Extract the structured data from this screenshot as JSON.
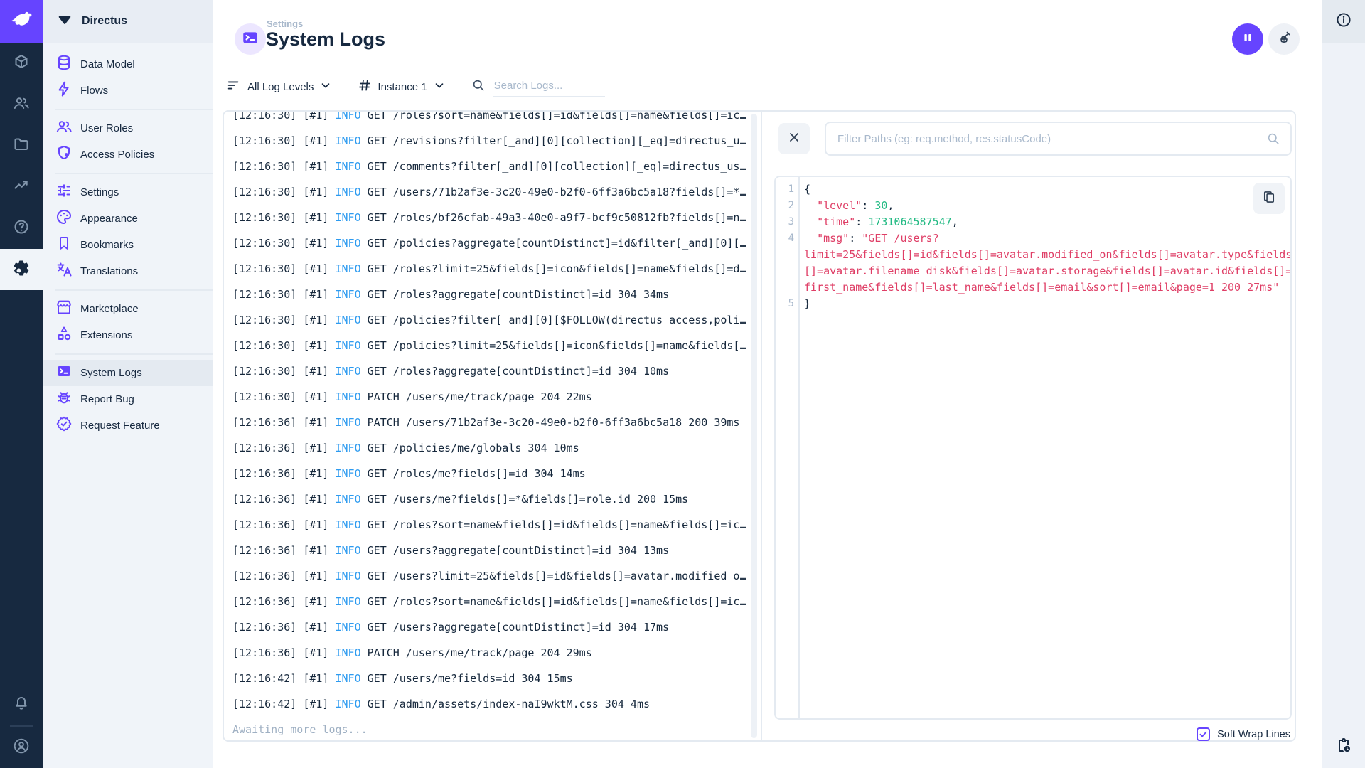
{
  "app": {
    "accent_color": "#6644ff",
    "info_blue": "#2d9bf0",
    "code_red": "#df3e66",
    "code_green": "#22ba83"
  },
  "nav": {
    "header_title": "Directus",
    "sections": [
      [
        {
          "id": "data-model",
          "icon": "database-icon",
          "label": "Data Model",
          "active": false
        },
        {
          "id": "flows",
          "icon": "bolt-icon",
          "label": "Flows",
          "active": false
        }
      ],
      [
        {
          "id": "user-roles",
          "icon": "people-icon",
          "label": "User Roles",
          "active": false
        },
        {
          "id": "access-policies",
          "icon": "shield-icon",
          "label": "Access Policies",
          "active": false
        }
      ],
      [
        {
          "id": "settings",
          "icon": "tune-icon",
          "label": "Settings",
          "active": false
        },
        {
          "id": "appearance",
          "icon": "palette-icon",
          "label": "Appearance",
          "active": false
        },
        {
          "id": "bookmarks",
          "icon": "bookmark-icon",
          "label": "Bookmarks",
          "active": false
        },
        {
          "id": "translations",
          "icon": "translate-icon",
          "label": "Translations",
          "active": false
        }
      ],
      [
        {
          "id": "marketplace",
          "icon": "storefront-icon",
          "label": "Marketplace",
          "active": false
        },
        {
          "id": "extensions",
          "icon": "shapes-icon",
          "label": "Extensions",
          "active": false
        }
      ],
      [
        {
          "id": "system-logs",
          "icon": "terminal-icon",
          "label": "System Logs",
          "active": true
        },
        {
          "id": "report-bug",
          "icon": "bug-icon",
          "label": "Report Bug",
          "active": false
        },
        {
          "id": "request-feature",
          "icon": "verified-icon",
          "label": "Request Feature",
          "active": false
        }
      ]
    ]
  },
  "header": {
    "breadcrumb": "Settings",
    "title": "System Logs"
  },
  "toolbar": {
    "log_level_filter": "All Log Levels",
    "instance_filter": "Instance 1",
    "search_placeholder": "Search Logs..."
  },
  "logs": {
    "awaiting": "Awaiting more logs...",
    "rows": [
      {
        "time": "12:16:30",
        "tag": "#1",
        "level": "INFO",
        "msg": "GET /roles?sort=name&fields[]=id&fields[]=name&fields[]=ic…"
      },
      {
        "time": "12:16:30",
        "tag": "#1",
        "level": "INFO",
        "msg": "GET /revisions?filter[_and][0][collection][_eq]=directus_u…"
      },
      {
        "time": "12:16:30",
        "tag": "#1",
        "level": "INFO",
        "msg": "GET /comments?filter[_and][0][collection][_eq]=directus_us…"
      },
      {
        "time": "12:16:30",
        "tag": "#1",
        "level": "INFO",
        "msg": "GET /users/71b2af3e-3c20-49e0-b2f0-6ff3a6bc5a18?fields[]=*…"
      },
      {
        "time": "12:16:30",
        "tag": "#1",
        "level": "INFO",
        "msg": "GET /roles/bf26cfab-49a3-40e0-a9f7-bcf9c50812fb?fields[]=n…"
      },
      {
        "time": "12:16:30",
        "tag": "#1",
        "level": "INFO",
        "msg": "GET /policies?aggregate[countDistinct]=id&filter[_and][0][…"
      },
      {
        "time": "12:16:30",
        "tag": "#1",
        "level": "INFO",
        "msg": "GET /roles?limit=25&fields[]=icon&fields[]=name&fields[]=d…"
      },
      {
        "time": "12:16:30",
        "tag": "#1",
        "level": "INFO",
        "msg": "GET /roles?aggregate[countDistinct]=id 304 34ms"
      },
      {
        "time": "12:16:30",
        "tag": "#1",
        "level": "INFO",
        "msg": "GET /policies?filter[_and][0][$FOLLOW(directus_access,poli…"
      },
      {
        "time": "12:16:30",
        "tag": "#1",
        "level": "INFO",
        "msg": "GET /policies?limit=25&fields[]=icon&fields[]=name&fields[…"
      },
      {
        "time": "12:16:30",
        "tag": "#1",
        "level": "INFO",
        "msg": "GET /roles?aggregate[countDistinct]=id 304 10ms"
      },
      {
        "time": "12:16:30",
        "tag": "#1",
        "level": "INFO",
        "msg": "PATCH /users/me/track/page 204 22ms"
      },
      {
        "time": "12:16:36",
        "tag": "#1",
        "level": "INFO",
        "msg": "PATCH /users/71b2af3e-3c20-49e0-b2f0-6ff3a6bc5a18 200 39ms"
      },
      {
        "time": "12:16:36",
        "tag": "#1",
        "level": "INFO",
        "msg": "GET /policies/me/globals 304 10ms"
      },
      {
        "time": "12:16:36",
        "tag": "#1",
        "level": "INFO",
        "msg": "GET /roles/me?fields[]=id 304 14ms"
      },
      {
        "time": "12:16:36",
        "tag": "#1",
        "level": "INFO",
        "msg": "GET /users/me?fields[]=*&fields[]=role.id 200 15ms"
      },
      {
        "time": "12:16:36",
        "tag": "#1",
        "level": "INFO",
        "msg": "GET /roles?sort=name&fields[]=id&fields[]=name&fields[]=ic…"
      },
      {
        "time": "12:16:36",
        "tag": "#1",
        "level": "INFO",
        "msg": "GET /users?aggregate[countDistinct]=id 304 13ms"
      },
      {
        "time": "12:16:36",
        "tag": "#1",
        "level": "INFO",
        "msg": "GET /users?limit=25&fields[]=id&fields[]=avatar.modified_o…"
      },
      {
        "time": "12:16:36",
        "tag": "#1",
        "level": "INFO",
        "msg": "GET /roles?sort=name&fields[]=id&fields[]=name&fields[]=ic…"
      },
      {
        "time": "12:16:36",
        "tag": "#1",
        "level": "INFO",
        "msg": "GET /users?aggregate[countDistinct]=id 304 17ms"
      },
      {
        "time": "12:16:36",
        "tag": "#1",
        "level": "INFO",
        "msg": "PATCH /users/me/track/page 204 29ms"
      },
      {
        "time": "12:16:42",
        "tag": "#1",
        "level": "INFO",
        "msg": "GET /users/me?fields=id 304 15ms"
      },
      {
        "time": "12:16:42",
        "tag": "#1",
        "level": "INFO",
        "msg": "GET /admin/assets/index-naI9wktM.css 304 4ms"
      }
    ]
  },
  "detail": {
    "filter_placeholder": "Filter Paths (eg: req.method, res.statusCode)",
    "soft_wrap_label": "Soft Wrap Lines",
    "soft_wrap_checked": true,
    "code": {
      "lines": [
        {
          "num": "1",
          "tokens": [
            {
              "t": "{",
              "c": "plain"
            }
          ]
        },
        {
          "num": "2",
          "tokens": [
            {
              "t": "  ",
              "c": "plain"
            },
            {
              "t": "\"level\"",
              "c": "key"
            },
            {
              "t": ": ",
              "c": "plain"
            },
            {
              "t": "30",
              "c": "num"
            },
            {
              "t": ",",
              "c": "plain"
            }
          ]
        },
        {
          "num": "3",
          "tokens": [
            {
              "t": "  ",
              "c": "plain"
            },
            {
              "t": "\"time\"",
              "c": "key"
            },
            {
              "t": ": ",
              "c": "plain"
            },
            {
              "t": "1731064587547",
              "c": "num"
            },
            {
              "t": ",",
              "c": "plain"
            }
          ]
        },
        {
          "num": "4",
          "tokens": [
            {
              "t": "  ",
              "c": "plain"
            },
            {
              "t": "\"msg\"",
              "c": "key"
            },
            {
              "t": ": ",
              "c": "plain"
            },
            {
              "t": "\"GET /users?",
              "c": "str"
            }
          ]
        },
        {
          "num": "",
          "tokens": [
            {
              "t": "limit=25&fields[]=id&fields[]=avatar.modified_on&fields[]=avatar.type&fields",
              "c": "str"
            }
          ]
        },
        {
          "num": "",
          "tokens": [
            {
              "t": "[]=avatar.filename_disk&fields[]=avatar.storage&fields[]=avatar.id&fields[]=",
              "c": "str"
            }
          ]
        },
        {
          "num": "",
          "tokens": [
            {
              "t": "first_name&fields[]=last_name&fields[]=email&sort[]=email&page=1 200 27ms\"",
              "c": "str"
            }
          ]
        },
        {
          "num": "5",
          "tokens": [
            {
              "t": "}",
              "c": "plain"
            }
          ]
        }
      ]
    }
  }
}
